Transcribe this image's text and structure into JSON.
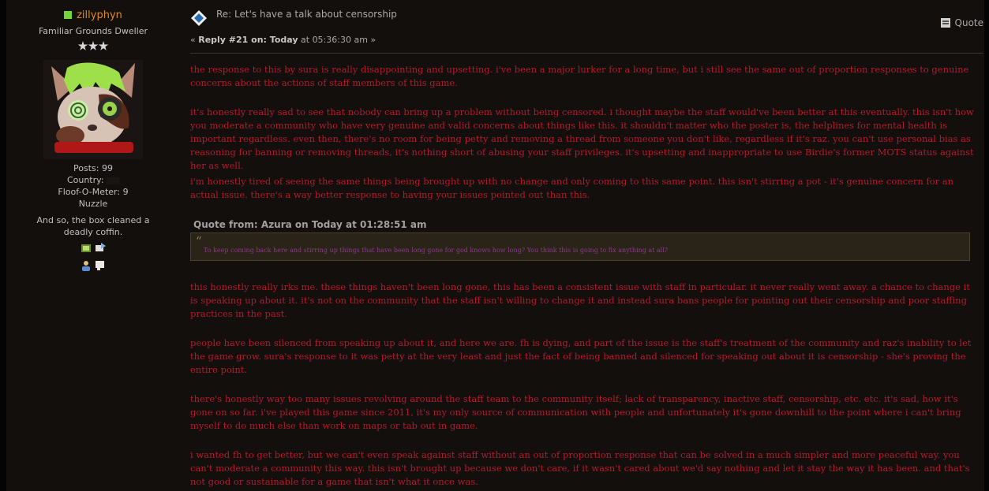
{
  "poster": {
    "name": "zillyphyn",
    "title": "Familiar Grounds Dweller",
    "posts": "Posts: 99",
    "country": "Country:",
    "floof": "Floof-O-Meter: 9",
    "nuzzle": "Nuzzle",
    "signature": "And so, the box cleaned a deadly coffin."
  },
  "post": {
    "subject": "Re: Let's have a talk about censorship",
    "reply_prefix": "« ",
    "reply_bold": "Reply #21 on: Today",
    "reply_time": " at 05:36:30 am »",
    "quote_label": "Quote"
  },
  "body": {
    "p1": "the response to this by sura is really disappointing and upsetting. i've been a major lurker for a long time, but i still see the same out of proportion responses to genuine concerns about the actions of staff members of this game.",
    "p2": "it's honestly really sad to see that nobody can bring up a problem without being censored. i thought maybe the staff would've been better at this eventually. this isn't how you moderate a community who have very genuine and valid concerns about things like this. it shouldn't matter who the poster is, the helplines for mental health is important regardless. even then, there's no room for being petty and removing a thread from someone you don't like, regardless if it's raz. you can't use personal bias as reasoning for banning or removing threads, it's nothing short of abusing your staff privileges. it's upsetting and inappropriate to use Birdie's former MOTS status against her as well.",
    "p3": "i'm honestly tired of seeing the same things being brought up with no change and only coming to this same point. this isn't stirring a pot - it's genuine concern for an actual issue. there's a way better response to having your issues pointed out than this.",
    "quote_header": "Quote from: Azura on Today at 01:28:51 am",
    "quote_text": "To keep coming back here and stirring up things that have been long gone for god knows how long? You think this is going to fix anything at all?",
    "p4": "this honestly really irks me. these things haven't been long gone, this has been a consistent issue with staff in particular. it never really went away. a chance to change it is speaking up about it. it's not on the community that the staff isn't willing to change it and instead sura bans people for pointing out their censorship and poor staffing practices in the past.",
    "p5": "people have been silenced from speaking up about it, and here we are. fh is dying, and part of the issue is the staff's treatment of the community and raz's inability to let the game grow. sura's response to it was petty at the very least and just the fact of being banned and silenced for speaking out about it is censorship - she's proving the entire point.",
    "p6": "there's honestly way too many issues revolving around the staff team to the community itself; lack of transparency, inactive staff, censorship, etc. etc. it's sad, how it's gone on so far. i've played this game since 2011, it's my only source of communication with people and unfortunately it's gone downhill to the point where i can't bring myself to do much else than work on maps or tab out in game.",
    "p7": "i wanted fh to get better, but we can't even speak against staff without an out of proportion response that can be solved in a much simpler and more peaceful way. you can't moderate a community this way. this isn't brought up because we don't care, if it wasn't cared about we'd say nothing and let it stay the way it has been. and that's not good or sustainable for a game that isn't what it once was."
  },
  "colors": {
    "background": "#120f0d",
    "body_text": "#b61a2c",
    "username": "#e08a1e",
    "online": "#6fd63b",
    "quote_bg": "#2a2317",
    "quote_text": "#8a3a8a"
  },
  "icons": {
    "online": "online-status-icon",
    "stars": "rank-star-icon",
    "subject": "post-xx-icon",
    "quote": "quote-icon",
    "profile_icons": [
      "website-icon",
      "pm-icon",
      "profile-icon",
      "message-icon"
    ]
  }
}
